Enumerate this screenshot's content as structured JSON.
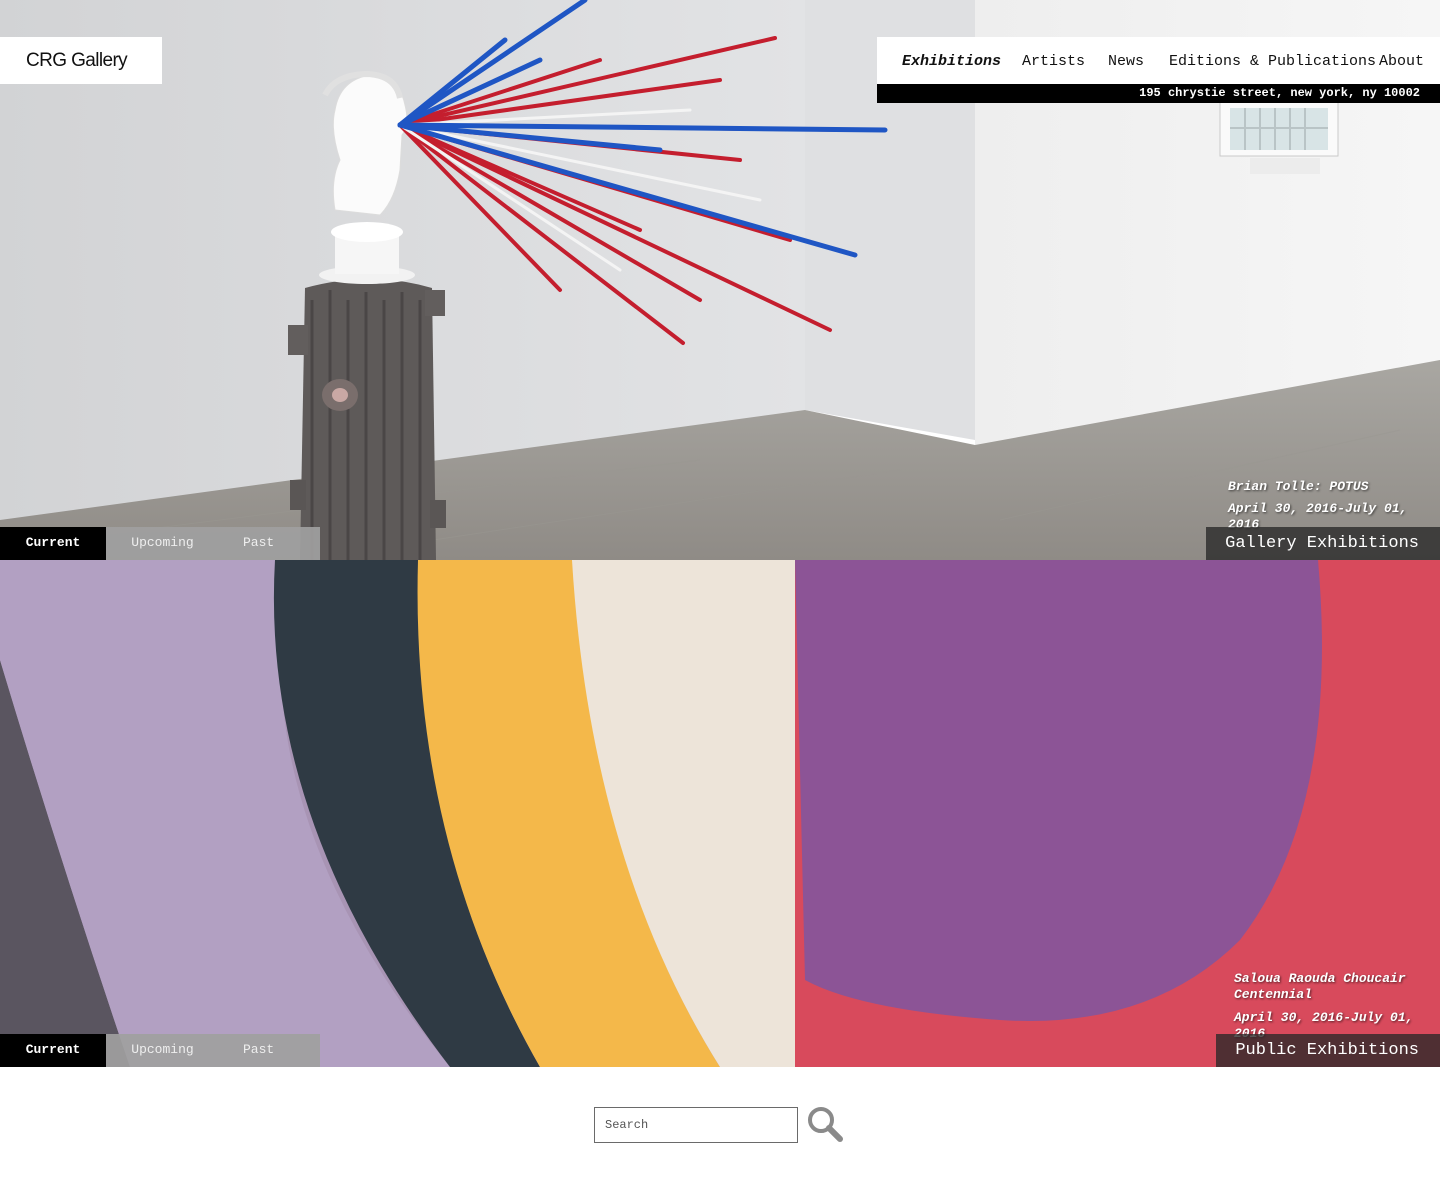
{
  "header": {
    "logo": "CRG Gallery",
    "nav": [
      "Exhibitions",
      "Artists",
      "News",
      "Editions & Publications",
      "About"
    ],
    "active_nav": "Exhibitions",
    "address": "195 chrystie street, new york, ny 10002"
  },
  "gallery": {
    "tabs": [
      "Current",
      "Upcoming",
      "Past"
    ],
    "active_tab": "Current",
    "label": "Gallery Exhibitions",
    "title": "Brian Tolle: POTUS",
    "dates": "April 30, 2016-July 01, 2016"
  },
  "public": {
    "tabs": [
      "Current",
      "Upcoming",
      "Past"
    ],
    "active_tab": "Current",
    "label": "Public Exhibitions",
    "title_line1": "Saloua Raouda Choucair",
    "title_line2": "Centennial",
    "dates": "April 30, 2016-July 01, 2016"
  },
  "search": {
    "placeholder": "Search",
    "icon": "search-icon"
  },
  "colors": {
    "nav_bar": "#000000",
    "tab_active": "#000000",
    "tab_inactive": "#a0a0a0",
    "label_bg": "#282828"
  }
}
